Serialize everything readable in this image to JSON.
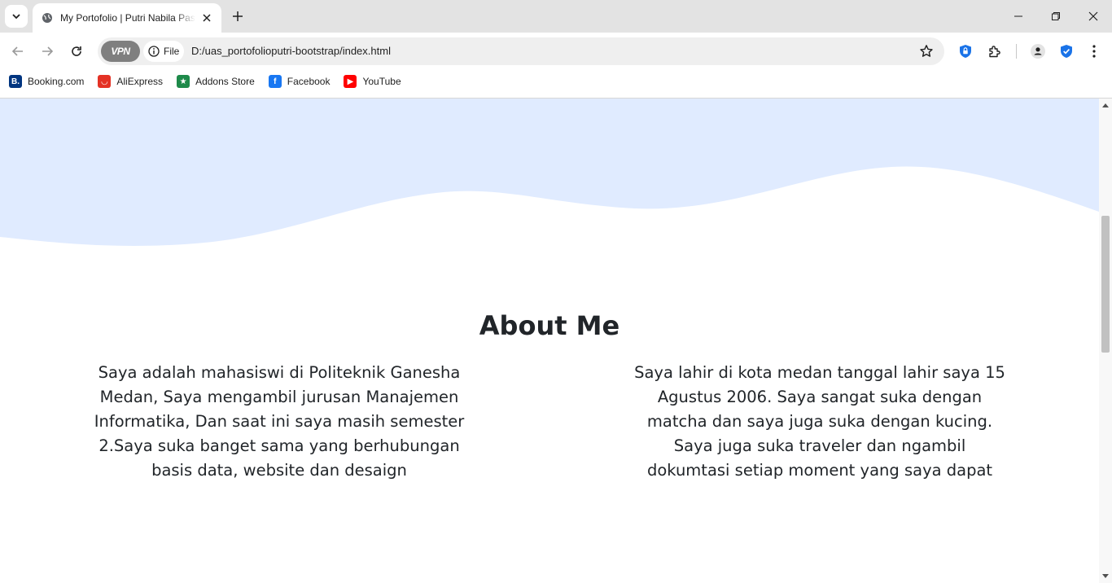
{
  "browser": {
    "tab_title": "My Portofolio | Putri Nabila Pasaribu",
    "omnibox": {
      "vpn_label": "VPN",
      "scheme_label": "File",
      "url": "D:/uas_portofolioputri-bootstrap/index.html"
    },
    "bookmarks": [
      {
        "label": "Booking.com",
        "icon": "booking-icon",
        "color": "#003580",
        "glyph": "B."
      },
      {
        "label": "AliExpress",
        "icon": "aliexpress-icon",
        "color": "#e43225",
        "glyph": "◡"
      },
      {
        "label": "Addons Store",
        "icon": "addons-store-icon",
        "color": "#1e8a4a",
        "glyph": "★"
      },
      {
        "label": "Facebook",
        "icon": "facebook-icon",
        "color": "#1877f2",
        "glyph": "f"
      },
      {
        "label": "YouTube",
        "icon": "youtube-icon",
        "color": "#ff0000",
        "glyph": "▶"
      }
    ]
  },
  "page": {
    "wave_color": "#e0ebff",
    "about": {
      "title": "About Me",
      "left_text": "Saya adalah mahasiswi di Politeknik Ganesha Medan, Saya mengambil jurusan Manajemen Informatika, Dan saat ini saya masih semester 2.Saya suka banget sama yang berhubungan basis data, website dan desaign",
      "right_text": "Saya lahir di kota medan tanggal lahir saya 15 Agustus 2006. Saya sangat suka dengan matcha dan saya juga suka dengan kucing. Saya juga suka traveler dan ngambil dokumtasi setiap moment yang saya dapat"
    }
  }
}
